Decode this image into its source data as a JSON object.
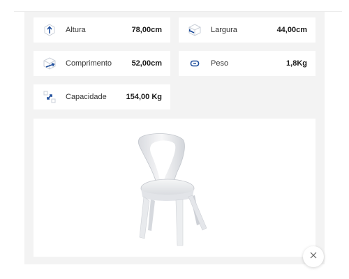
{
  "specs": {
    "altura": {
      "label": "Altura",
      "value": "78,00cm",
      "icon": "arrow-up-icon"
    },
    "largura": {
      "label": "Largura",
      "value": "44,00cm",
      "icon": "width-box-icon"
    },
    "comprimento": {
      "label": "Comprimento",
      "value": "52,00cm",
      "icon": "length-box-icon"
    },
    "peso": {
      "label": "Peso",
      "value": "1,8Kg",
      "icon": "weight-icon"
    },
    "capacidade": {
      "label": "Capacidade",
      "value": "154,00 Kg",
      "icon": "capacity-arrows-icon"
    }
  },
  "product_image": {
    "alt": "chair-image"
  },
  "close": {
    "icon": "close-icon"
  },
  "colors": {
    "accent": "#1f4e9c",
    "panel": "#f3f3f3",
    "card": "#ffffff"
  }
}
